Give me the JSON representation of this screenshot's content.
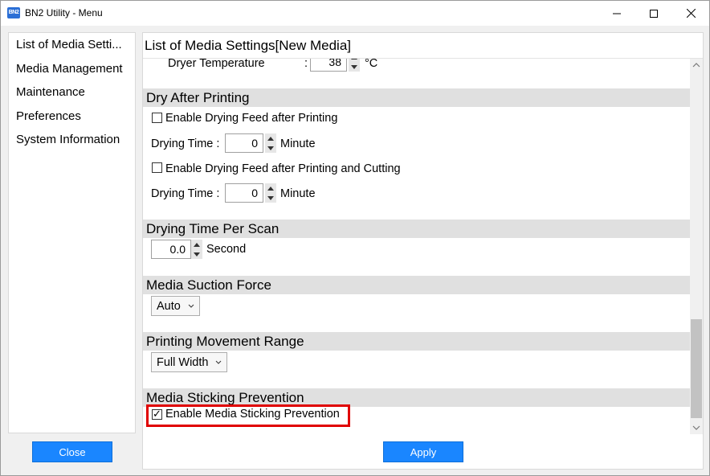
{
  "window": {
    "title": "BN2 Utility - Menu",
    "icon_text": "BN2",
    "controls": [
      "minimize-icon",
      "maximize-icon",
      "close-icon"
    ]
  },
  "sidebar": {
    "items": [
      {
        "label": "List of Media Setti..."
      },
      {
        "label": "Media Management"
      },
      {
        "label": "Maintenance"
      },
      {
        "label": "Preferences"
      },
      {
        "label": "System Information"
      }
    ],
    "close_label": "Close"
  },
  "panel": {
    "title": "List of Media Settings[New Media]",
    "dryer": {
      "label": "Dryer Temperature",
      "colon": ":",
      "value": "38",
      "unit": "°C"
    },
    "dry_after_printing": {
      "header": "Dry After Printing",
      "feed_after_printing": {
        "label": "Enable Drying Feed after Printing",
        "checked": false
      },
      "time1": {
        "label": "Drying Time :",
        "value": "0",
        "unit": "Minute"
      },
      "feed_after_cutting": {
        "label": "Enable Drying Feed after Printing and Cutting",
        "checked": false
      },
      "time2": {
        "label": "Drying Time :",
        "value": "0",
        "unit": "Minute"
      }
    },
    "drying_time_per_scan": {
      "header": "Drying Time Per Scan",
      "value": "0.0",
      "unit": "Second"
    },
    "media_suction_force": {
      "header": "Media Suction Force",
      "value": "Auto"
    },
    "printing_movement_range": {
      "header": "Printing Movement Range",
      "value": "Full Width"
    },
    "media_sticking_prevention": {
      "header": "Media Sticking Prevention",
      "enable": {
        "label": "Enable Media Sticking Prevention",
        "checked": true
      }
    },
    "apply_label": "Apply"
  },
  "colors": {
    "accent": "#1a86ff",
    "highlight": "#e00000",
    "section_bg": "#e0e0e0"
  }
}
